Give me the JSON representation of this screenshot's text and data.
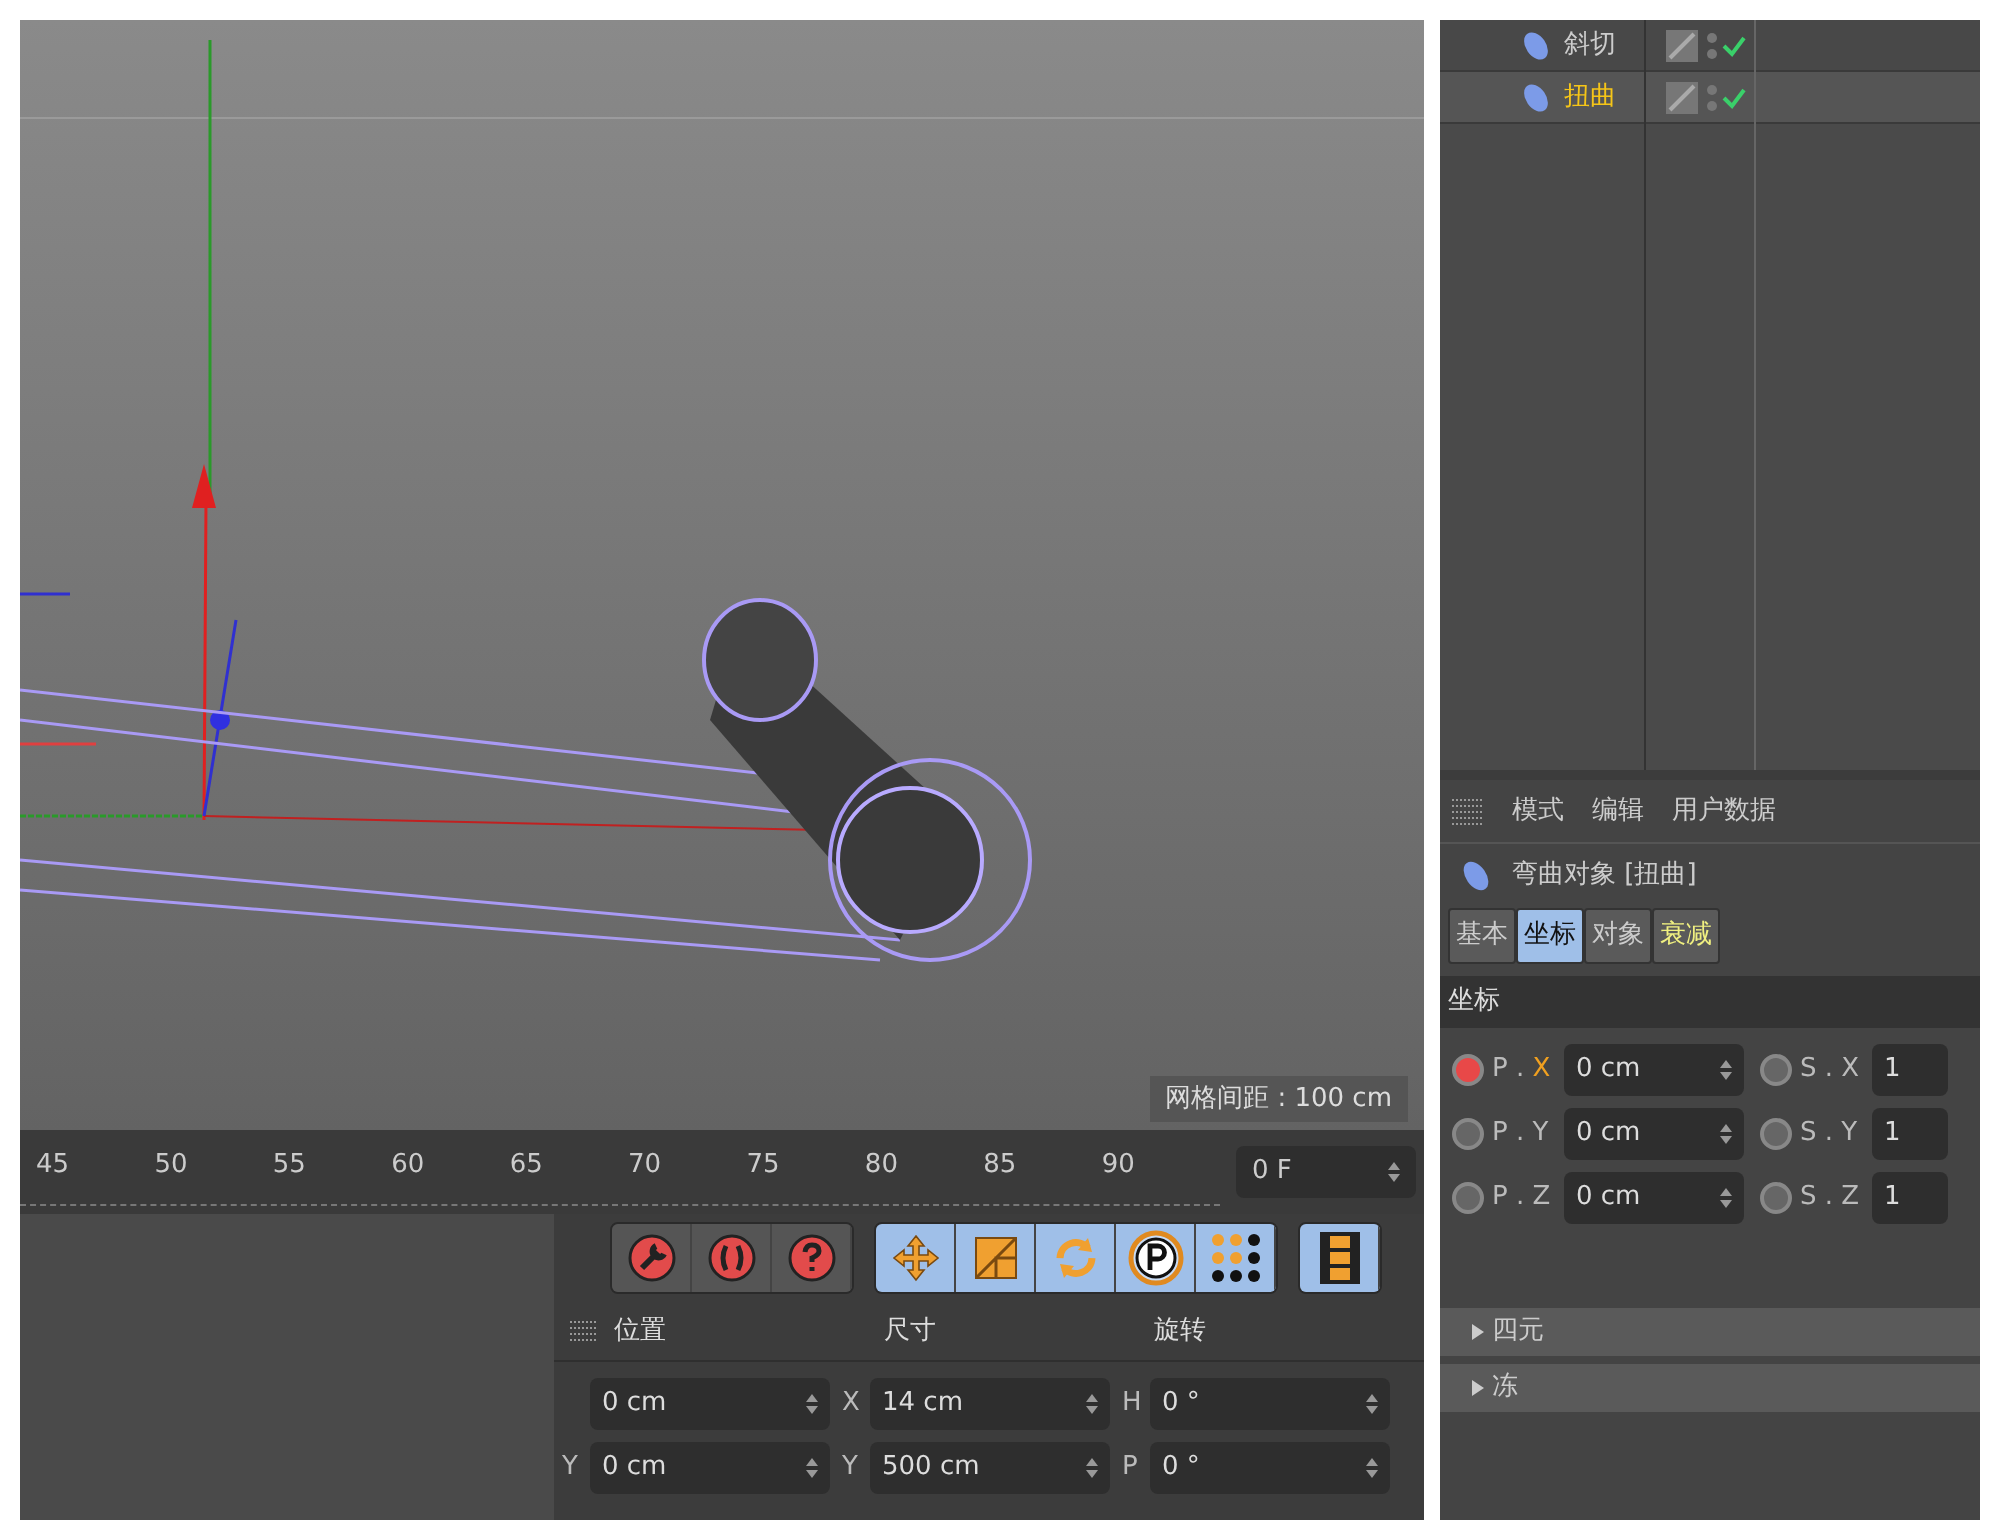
{
  "viewport": {
    "grid_label": "网格间距 : 100 cm"
  },
  "timeline": {
    "ticks": [
      "45",
      "50",
      "55",
      "60",
      "65",
      "70",
      "75",
      "80",
      "85",
      "90"
    ],
    "frame": "0 F"
  },
  "toolbar": {
    "groups": [
      {
        "kind": "tools"
      },
      {
        "kind": "transform"
      },
      {
        "kind": "timeline"
      }
    ]
  },
  "coordinates": {
    "headers": [
      "位置",
      "尺寸",
      "旋转"
    ],
    "rows": [
      [
        {
          "value": "0 cm"
        },
        {
          "label": "X",
          "value": "14 cm"
        },
        {
          "label": "H",
          "value": "0 °"
        }
      ],
      [
        {
          "label": "Y",
          "value": "0 cm"
        },
        {
          "label": "Y",
          "value": "500 cm"
        },
        {
          "label": "P",
          "value": "0 °"
        }
      ]
    ]
  },
  "outliner": {
    "rows": [
      {
        "name": "斜切",
        "selected": false
      },
      {
        "name": "扭曲",
        "selected": true
      }
    ]
  },
  "attributes": {
    "menu": [
      "模式",
      "编辑",
      "用户数据"
    ],
    "title": "弯曲对象 [扭曲]",
    "tabs": [
      {
        "label": "基本",
        "selected": false,
        "accent": false
      },
      {
        "label": "坐标",
        "selected": true,
        "accent": false
      },
      {
        "label": "对象",
        "selected": false,
        "accent": false
      },
      {
        "label": "衰减",
        "selected": false,
        "accent": true
      }
    ],
    "section": "坐标",
    "rows": [
      [
        {
          "prefix": "P .",
          "axis": "X",
          "value": "0 cm",
          "animated": true,
          "axis_highlight": true
        },
        {
          "prefix": "S .",
          "axis": "X",
          "value": "1",
          "animated": false,
          "axis_highlight": false
        }
      ],
      [
        {
          "prefix": "P .",
          "axis": "Y",
          "value": "0 cm",
          "animated": false,
          "axis_highlight": false
        },
        {
          "prefix": "S .",
          "axis": "Y",
          "value": "1",
          "animated": false,
          "axis_highlight": false
        }
      ],
      [
        {
          "prefix": "P .",
          "axis": "Z",
          "value": "0 cm",
          "animated": false,
          "axis_highlight": false
        },
        {
          "prefix": "S .",
          "axis": "Z",
          "value": "1",
          "animated": false,
          "axis_highlight": false
        }
      ]
    ],
    "groups": [
      {
        "label": "四元"
      },
      {
        "label": "冻"
      }
    ]
  }
}
